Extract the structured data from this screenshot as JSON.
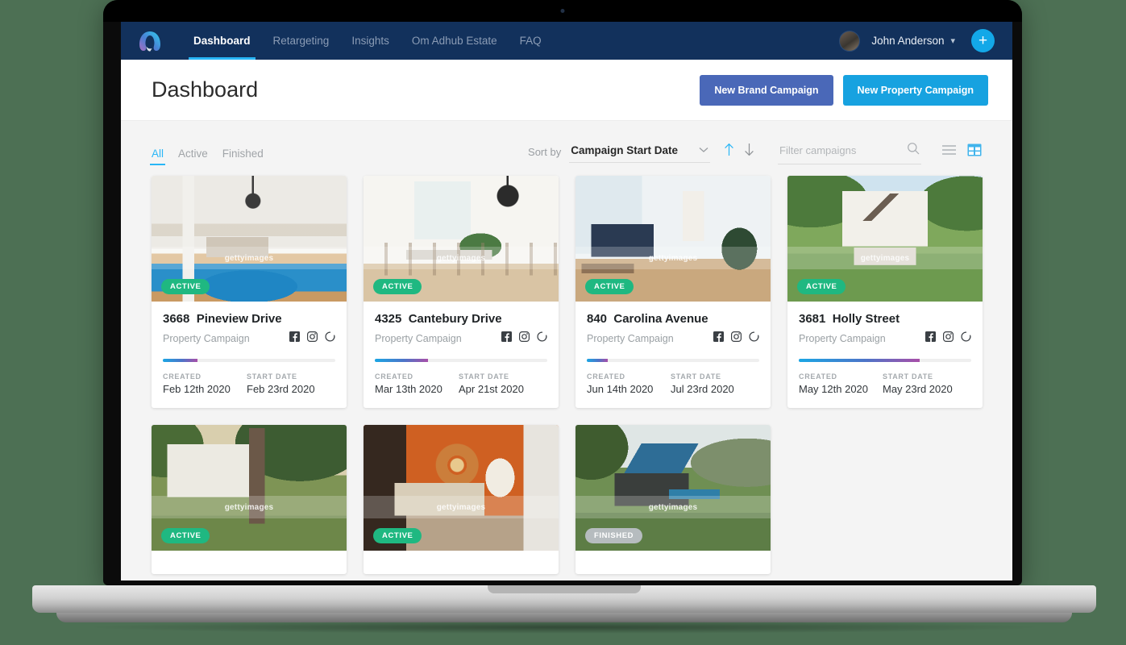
{
  "background_color": "#4d7054",
  "topnav": {
    "brand_icon": "arc-logo-icon",
    "items": [
      {
        "label": "Dashboard",
        "active": true
      },
      {
        "label": "Retargeting",
        "active": false
      },
      {
        "label": "Insights",
        "active": false
      },
      {
        "label": "Om Adhub Estate",
        "active": false
      },
      {
        "label": "FAQ",
        "active": false
      }
    ],
    "user_name": "John Anderson",
    "caret_icon": "chevron-down-icon",
    "add_button_label": "+",
    "bg_color": "#12315c",
    "accent_color": "#29b6f6"
  },
  "header": {
    "title": "Dashboard",
    "new_brand_campaign": "New Brand Campaign",
    "new_property_campaign": "New Property Campaign",
    "brand_btn_color": "#4a68b8",
    "property_btn_color": "#17a2e0"
  },
  "filterbar": {
    "tabs": [
      {
        "label": "All",
        "active": true
      },
      {
        "label": "Active",
        "active": false
      },
      {
        "label": "Finished",
        "active": false
      }
    ],
    "sort_label": "Sort by",
    "sort_value": "Campaign Start Date",
    "sort_caret_icon": "chevron-down-icon",
    "sort_asc_icon": "arrow-up-icon",
    "sort_desc_icon": "arrow-down-icon",
    "filter_placeholder": "Filter campaigns",
    "filter_value": "",
    "search_icon": "search-icon",
    "list_view_icon": "list-view-icon",
    "grid_view_icon": "grid-view-icon",
    "active_view": "grid"
  },
  "cards": [
    {
      "badge": "ACTIVE",
      "badge_state": "active",
      "number": "3668",
      "street": "Pineview Drive",
      "subtitle": "Property Campaign",
      "socials": [
        "facebook-icon",
        "instagram-icon",
        "google-icon"
      ],
      "progress_pct": 20,
      "created_label": "CREATED",
      "created_value": "Feb 12th 2020",
      "start_label": "START DATE",
      "start_value": "Feb 23rd 2020",
      "scene": "living-room-blue-rug",
      "watermark": "gettyimages"
    },
    {
      "badge": "ACTIVE",
      "badge_state": "active",
      "number": "4325",
      "street": "Cantebury Drive",
      "subtitle": "Property Campaign",
      "socials": [
        "facebook-icon",
        "instagram-icon",
        "google-icon"
      ],
      "progress_pct": 31,
      "created_label": "CREATED",
      "created_value": "Mar 13th 2020",
      "start_label": "START DATE",
      "start_value": "Apr 21st 2020",
      "scene": "dining-room-pendant",
      "watermark": "gettyimages"
    },
    {
      "badge": "ACTIVE",
      "badge_state": "active",
      "number": "840",
      "street": "Carolina Avenue",
      "subtitle": "Property Campaign",
      "socials": [
        "facebook-icon",
        "instagram-icon",
        "google-icon"
      ],
      "progress_pct": 12,
      "created_label": "CREATED",
      "created_value": "Jun 14th 2020",
      "start_label": "START DATE",
      "start_value": "Jul 23rd 2020",
      "scene": "lounge-window-light",
      "watermark": "gettyimages"
    },
    {
      "badge": "ACTIVE",
      "badge_state": "active",
      "number": "3681",
      "street": "Holly Street",
      "subtitle": "Property Campaign",
      "socials": [
        "facebook-icon",
        "instagram-icon",
        "google-icon"
      ],
      "progress_pct": 70,
      "created_label": "CREATED",
      "created_value": "May 12th 2020",
      "start_label": "START DATE",
      "start_value": "May 23rd 2020",
      "scene": "white-house-garden",
      "watermark": "gettyimages"
    },
    {
      "badge": "ACTIVE",
      "badge_state": "active",
      "scene": "farmhouse-sunset",
      "watermark": "gettyimages"
    },
    {
      "badge": "ACTIVE",
      "badge_state": "active",
      "scene": "orange-wall-living-room",
      "watermark": "gettyimages"
    },
    {
      "badge": "FINISHED",
      "badge_state": "finished",
      "scene": "hillside-modern-house",
      "watermark": "gettyimages"
    }
  ]
}
